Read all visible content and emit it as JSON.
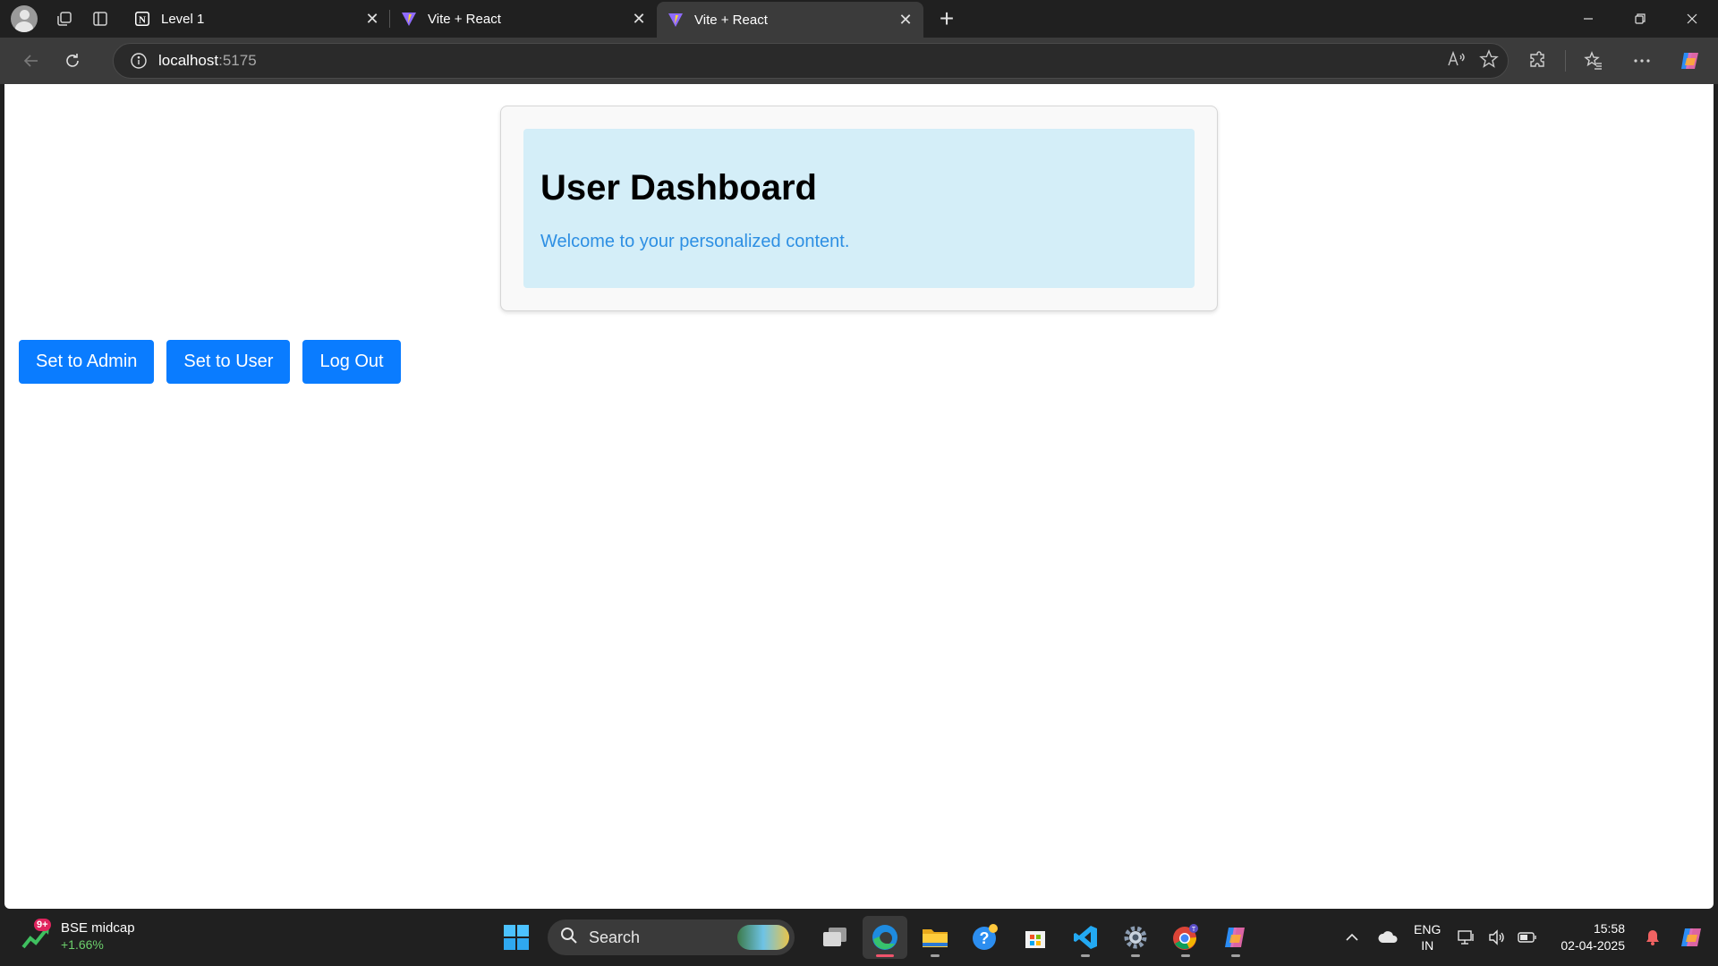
{
  "browser": {
    "tabs": [
      {
        "title": "Level 1",
        "favicon": "notion-icon",
        "active": false
      },
      {
        "title": "Vite + React",
        "favicon": "vite-icon",
        "active": false
      },
      {
        "title": "Vite + React",
        "favicon": "vite-icon",
        "active": true
      }
    ],
    "address": {
      "host": "localhost",
      "port": ":5175"
    }
  },
  "page": {
    "title": "User Dashboard",
    "welcome": "Welcome to your personalized content.",
    "buttons": {
      "admin": "Set to Admin",
      "user": "Set to User",
      "logout": "Log Out"
    }
  },
  "taskbar": {
    "widget": {
      "badge": "9+",
      "name": "BSE midcap",
      "change": "+1.66%"
    },
    "search_label": "Search",
    "lang": {
      "line1": "ENG",
      "line2": "IN"
    },
    "clock": {
      "time": "15:58",
      "date": "02-04-2025"
    }
  },
  "colors": {
    "accent_button": "#0a7cff",
    "card_bg": "#d4eef8",
    "welcome_text": "#2d8fe3",
    "market_up": "#6ccf6c"
  }
}
